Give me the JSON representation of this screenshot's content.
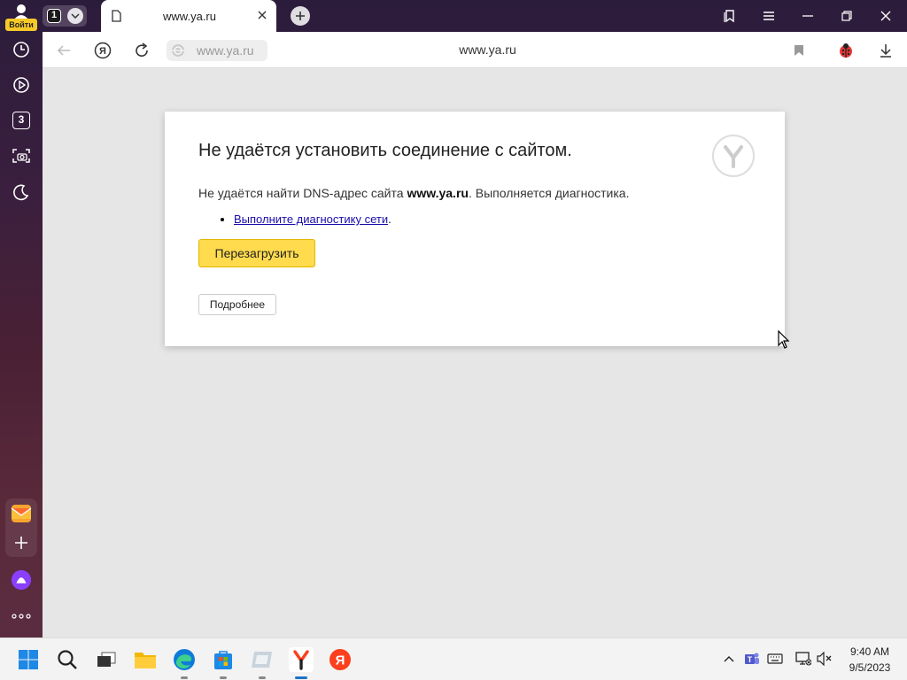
{
  "sidebar": {
    "login_label": "Войти",
    "items": [
      {
        "icon": "history-icon"
      },
      {
        "icon": "play-icon"
      },
      {
        "icon": "collections-icon",
        "badge": "3"
      },
      {
        "icon": "screenshot-icon"
      },
      {
        "icon": "moon-icon"
      }
    ],
    "bottom": [
      {
        "icon": "mail-icon"
      },
      {
        "icon": "add-icon"
      },
      {
        "icon": "alice-icon"
      },
      {
        "icon": "more-icon"
      }
    ]
  },
  "tabs": {
    "count": "1",
    "active_tab_title": "www.ya.ru"
  },
  "addressbar": {
    "url_pill": "www.ya.ru",
    "page_title": "www.ya.ru"
  },
  "error": {
    "title": "Не удаётся установить соединение с сайтом.",
    "message_prefix": "Не удаётся найти DNS-адрес сайта ",
    "message_host": "www.ya.ru",
    "message_suffix": ". Выполняется диагностика.",
    "link": "Выполните диагностику сети",
    "link_suffix": ".",
    "reload_button": "Перезагрузить",
    "details_button": "Подробнее"
  },
  "taskbar": {
    "time": "9:40 AM",
    "date": "9/5/2023"
  },
  "colors": {
    "accent_yellow": "#ffdb4d",
    "yandex_red": "#fc3f1d"
  }
}
